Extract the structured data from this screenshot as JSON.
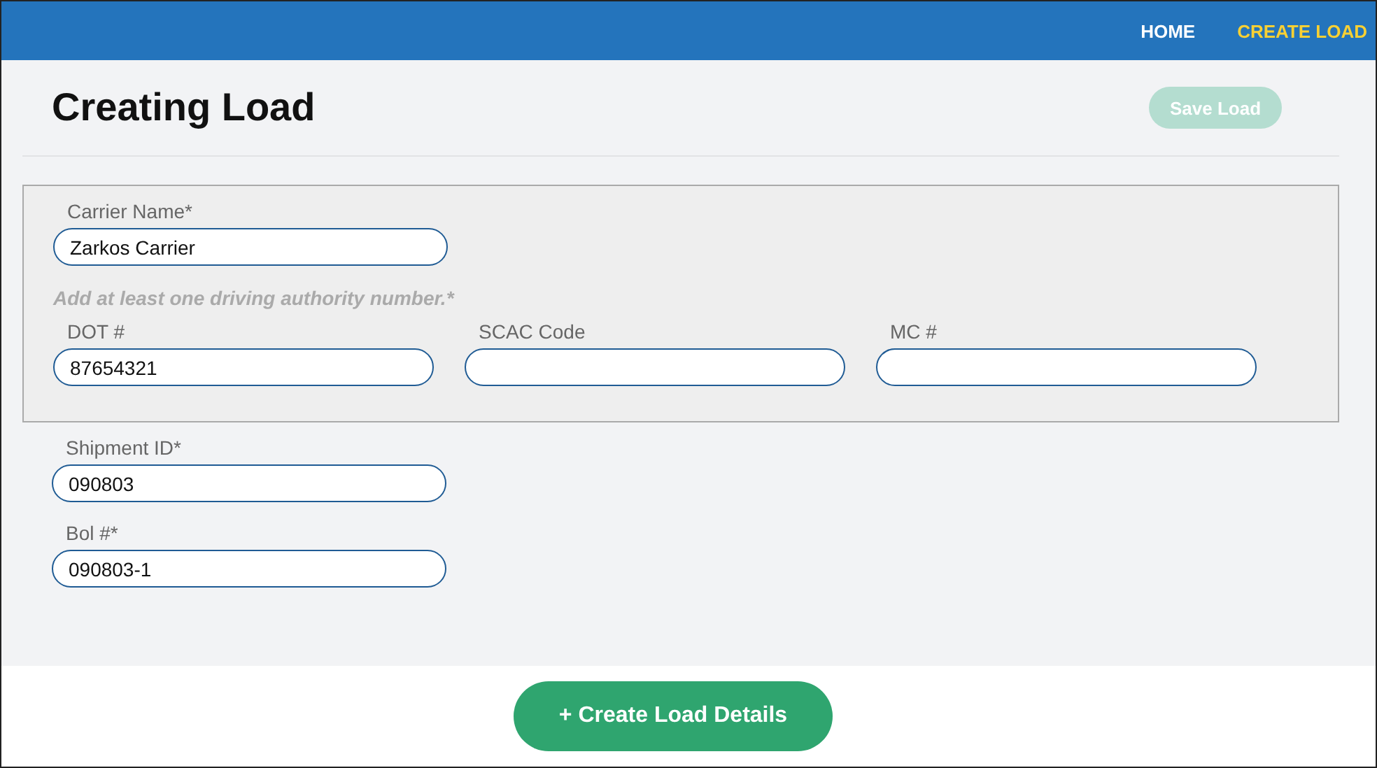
{
  "nav": [
    {
      "label": "HOME",
      "selected": false
    },
    {
      "label": "CREATE LOAD",
      "selected": true
    }
  ],
  "title": "Creating Load",
  "save_button": {
    "label": "Save Load",
    "disabled": true
  },
  "carrier": {
    "label": "Carrier Name*",
    "value": "Zarkos Carrier"
  },
  "authority_hint": "Add at least one driving authority number.*",
  "authority_fields": [
    {
      "label": "DOT #",
      "value": "87654321"
    },
    {
      "label": "SCAC Code"
    },
    {
      "label": "MC #"
    }
  ],
  "fields": [
    {
      "label": "Shipment ID*",
      "value": "090803"
    },
    {
      "label": "Bol #*",
      "value": "090803-1"
    }
  ],
  "create_button": "+ Create Load Details"
}
